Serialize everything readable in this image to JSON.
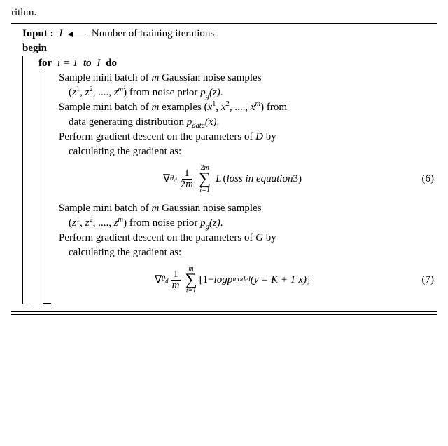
{
  "caption_tail": "rithm.",
  "input_kw": "Input :",
  "input_var": "I",
  "input_desc": " Number of training iterations",
  "begin_kw": "begin",
  "for_kw": "for",
  "for_var": "i = 1",
  "to_kw": "to",
  "for_end": "I",
  "do_kw": "do",
  "step1a": "Sample mini batch of ",
  "step1_m": "m",
  "step1b": " Gaussian noise samples",
  "step1c_open": "(",
  "step1c_z1": "z",
  "step1c_s1": "1",
  "step1c_comma": ", ",
  "step1c_z2": "z",
  "step1c_s2": "2",
  "step1c_dots": ", ...., ",
  "step1c_zm": "z",
  "step1c_sm": "m",
  "step1c_close": ")",
  "step1d": " from noise prior ",
  "step1_pg": "p",
  "step1_g": "g",
  "step1_zarg": "(z)",
  "step1_dot": ".",
  "step2a": "Sample mini batch of ",
  "step2_m": "m",
  "step2b": " examples (",
  "step2_x1": "x",
  "step2_s1": "1",
  "step2_c1": ", ",
  "step2_x2": "x",
  "step2_s2": "2",
  "step2_dots": ", ...., ",
  "step2_xm": "x",
  "step2_sm": "m",
  "step2_close": ") from",
  "step2c": "data generating distribution ",
  "step2_p": "p",
  "step2_data": "data",
  "step2_xarg": "(x)",
  "step2_dot": ".",
  "step3a": "Perform gradient descent on the parameters of ",
  "step3_D": "D",
  "step3b": " by",
  "step3c": "calculating the gradient as:",
  "eq6": {
    "nabla": "∇",
    "theta": "θ",
    "sub": "d",
    "frac_num": "1",
    "frac_den_a": "2",
    "frac_den_m": "m",
    "sum_top": "2m",
    "sum_bot": "i=1",
    "L": "L",
    "paren_open": " (",
    "text": "loss in equation ",
    "ref": "3",
    "paren_close": ")",
    "num": "(6)"
  },
  "step4a": "Sample mini batch of ",
  "step4_m": "m",
  "step4b": " Gaussian noise samples",
  "step4c_open": "(",
  "step4_z1": "z",
  "step4_s1": "1",
  "step4_c1": ", ",
  "step4_z2": "z",
  "step4_s2": "2",
  "step4_dots": ", ...., ",
  "step4_zm": "z",
  "step4_sm": "m",
  "step4_close": ")",
  "step4d": " from noise prior ",
  "step4_pg": "p",
  "step4_g": "g",
  "step4_zarg": "(z)",
  "step4_dot": ".",
  "step5a": "Perform gradient descent on the parameters of ",
  "step5_G": "G",
  "step5b": " by",
  "step5c": "calculating the gradient as:",
  "eq7": {
    "nabla": "∇",
    "theta": "θ",
    "sub": "d",
    "frac_num": "1",
    "frac_den_m": "m",
    "sum_top": "m",
    "sum_bot": "i=1",
    "lbrack": "[",
    "one": "1",
    "minus": " − ",
    "log": "log",
    "space": " ",
    "p": "p",
    "model": "model",
    "paren": "(y = K + 1|x)",
    "rbrack": "]",
    "num": "(7)"
  }
}
